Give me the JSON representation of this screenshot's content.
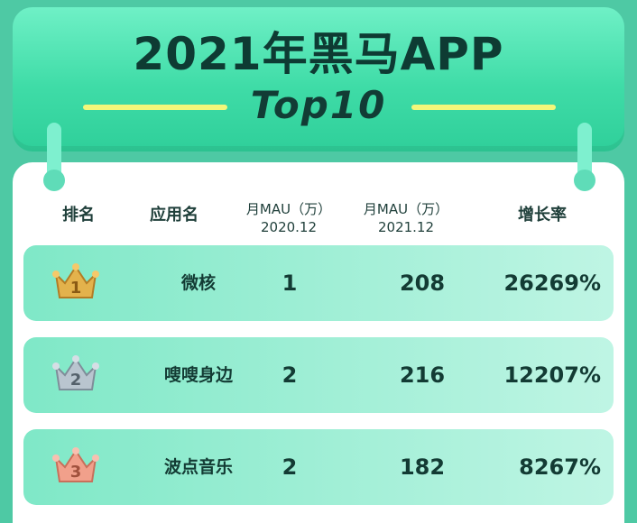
{
  "banner": {
    "title": "2021年黑马APP",
    "subtitle": "Top10"
  },
  "table": {
    "headers": {
      "rank": "排名",
      "app": "应用名",
      "mau_2020_line1": "月MAU（万）",
      "mau_2020_line2": "2020.12",
      "mau_2021_line1": "月MAU（万）",
      "mau_2021_line2": "2021.12",
      "growth": "增长率"
    },
    "rows": [
      {
        "rank": "1",
        "app": "微核",
        "mau_2020": "1",
        "mau_2021": "208",
        "growth": "26269%"
      },
      {
        "rank": "2",
        "app": "嗖嗖身边",
        "mau_2020": "2",
        "mau_2021": "216",
        "growth": "12207%"
      },
      {
        "rank": "3",
        "app": "波点音乐",
        "mau_2020": "2",
        "mau_2021": "182",
        "growth": "8267%"
      }
    ]
  },
  "colors": {
    "gold_crown": "#e3b24c",
    "silver_crown": "#b9c5cf",
    "bronze_crown": "#f1a08b"
  },
  "icons": [
    "crown-gold-icon",
    "crown-silver-icon",
    "crown-bronze-icon"
  ]
}
